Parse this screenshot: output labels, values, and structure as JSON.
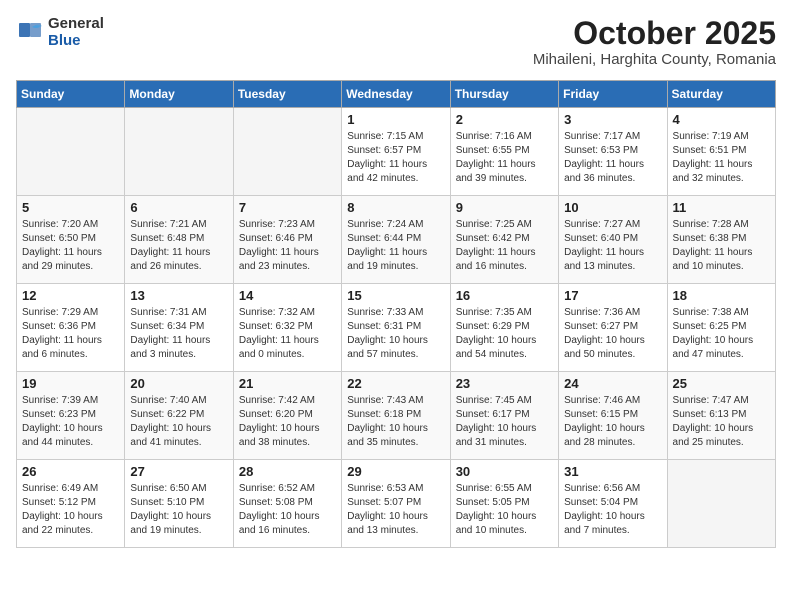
{
  "logo": {
    "general": "General",
    "blue": "Blue"
  },
  "title": "October 2025",
  "location": "Mihaileni, Harghita County, Romania",
  "days_of_week": [
    "Sunday",
    "Monday",
    "Tuesday",
    "Wednesday",
    "Thursday",
    "Friday",
    "Saturday"
  ],
  "weeks": [
    [
      {
        "day": "",
        "info": ""
      },
      {
        "day": "",
        "info": ""
      },
      {
        "day": "",
        "info": ""
      },
      {
        "day": "1",
        "info": "Sunrise: 7:15 AM\nSunset: 6:57 PM\nDaylight: 11 hours\nand 42 minutes."
      },
      {
        "day": "2",
        "info": "Sunrise: 7:16 AM\nSunset: 6:55 PM\nDaylight: 11 hours\nand 39 minutes."
      },
      {
        "day": "3",
        "info": "Sunrise: 7:17 AM\nSunset: 6:53 PM\nDaylight: 11 hours\nand 36 minutes."
      },
      {
        "day": "4",
        "info": "Sunrise: 7:19 AM\nSunset: 6:51 PM\nDaylight: 11 hours\nand 32 minutes."
      }
    ],
    [
      {
        "day": "5",
        "info": "Sunrise: 7:20 AM\nSunset: 6:50 PM\nDaylight: 11 hours\nand 29 minutes."
      },
      {
        "day": "6",
        "info": "Sunrise: 7:21 AM\nSunset: 6:48 PM\nDaylight: 11 hours\nand 26 minutes."
      },
      {
        "day": "7",
        "info": "Sunrise: 7:23 AM\nSunset: 6:46 PM\nDaylight: 11 hours\nand 23 minutes."
      },
      {
        "day": "8",
        "info": "Sunrise: 7:24 AM\nSunset: 6:44 PM\nDaylight: 11 hours\nand 19 minutes."
      },
      {
        "day": "9",
        "info": "Sunrise: 7:25 AM\nSunset: 6:42 PM\nDaylight: 11 hours\nand 16 minutes."
      },
      {
        "day": "10",
        "info": "Sunrise: 7:27 AM\nSunset: 6:40 PM\nDaylight: 11 hours\nand 13 minutes."
      },
      {
        "day": "11",
        "info": "Sunrise: 7:28 AM\nSunset: 6:38 PM\nDaylight: 11 hours\nand 10 minutes."
      }
    ],
    [
      {
        "day": "12",
        "info": "Sunrise: 7:29 AM\nSunset: 6:36 PM\nDaylight: 11 hours\nand 6 minutes."
      },
      {
        "day": "13",
        "info": "Sunrise: 7:31 AM\nSunset: 6:34 PM\nDaylight: 11 hours\nand 3 minutes."
      },
      {
        "day": "14",
        "info": "Sunrise: 7:32 AM\nSunset: 6:32 PM\nDaylight: 11 hours\nand 0 minutes."
      },
      {
        "day": "15",
        "info": "Sunrise: 7:33 AM\nSunset: 6:31 PM\nDaylight: 10 hours\nand 57 minutes."
      },
      {
        "day": "16",
        "info": "Sunrise: 7:35 AM\nSunset: 6:29 PM\nDaylight: 10 hours\nand 54 minutes."
      },
      {
        "day": "17",
        "info": "Sunrise: 7:36 AM\nSunset: 6:27 PM\nDaylight: 10 hours\nand 50 minutes."
      },
      {
        "day": "18",
        "info": "Sunrise: 7:38 AM\nSunset: 6:25 PM\nDaylight: 10 hours\nand 47 minutes."
      }
    ],
    [
      {
        "day": "19",
        "info": "Sunrise: 7:39 AM\nSunset: 6:23 PM\nDaylight: 10 hours\nand 44 minutes."
      },
      {
        "day": "20",
        "info": "Sunrise: 7:40 AM\nSunset: 6:22 PM\nDaylight: 10 hours\nand 41 minutes."
      },
      {
        "day": "21",
        "info": "Sunrise: 7:42 AM\nSunset: 6:20 PM\nDaylight: 10 hours\nand 38 minutes."
      },
      {
        "day": "22",
        "info": "Sunrise: 7:43 AM\nSunset: 6:18 PM\nDaylight: 10 hours\nand 35 minutes."
      },
      {
        "day": "23",
        "info": "Sunrise: 7:45 AM\nSunset: 6:17 PM\nDaylight: 10 hours\nand 31 minutes."
      },
      {
        "day": "24",
        "info": "Sunrise: 7:46 AM\nSunset: 6:15 PM\nDaylight: 10 hours\nand 28 minutes."
      },
      {
        "day": "25",
        "info": "Sunrise: 7:47 AM\nSunset: 6:13 PM\nDaylight: 10 hours\nand 25 minutes."
      }
    ],
    [
      {
        "day": "26",
        "info": "Sunrise: 6:49 AM\nSunset: 5:12 PM\nDaylight: 10 hours\nand 22 minutes."
      },
      {
        "day": "27",
        "info": "Sunrise: 6:50 AM\nSunset: 5:10 PM\nDaylight: 10 hours\nand 19 minutes."
      },
      {
        "day": "28",
        "info": "Sunrise: 6:52 AM\nSunset: 5:08 PM\nDaylight: 10 hours\nand 16 minutes."
      },
      {
        "day": "29",
        "info": "Sunrise: 6:53 AM\nSunset: 5:07 PM\nDaylight: 10 hours\nand 13 minutes."
      },
      {
        "day": "30",
        "info": "Sunrise: 6:55 AM\nSunset: 5:05 PM\nDaylight: 10 hours\nand 10 minutes."
      },
      {
        "day": "31",
        "info": "Sunrise: 6:56 AM\nSunset: 5:04 PM\nDaylight: 10 hours\nand 7 minutes."
      },
      {
        "day": "",
        "info": ""
      }
    ]
  ]
}
